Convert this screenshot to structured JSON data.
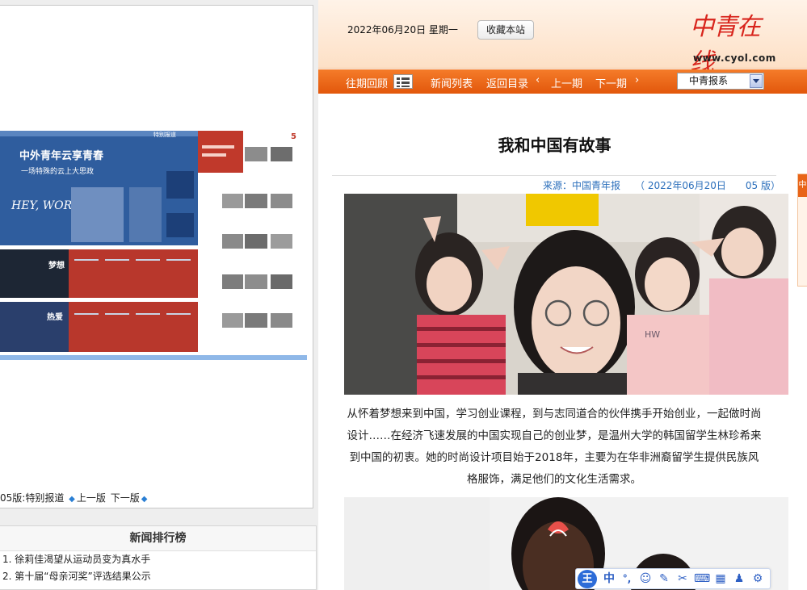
{
  "left": {
    "page_nav": {
      "current": "05版:特别报道",
      "prev": "上一版",
      "next": "下一版"
    },
    "paper_page": {
      "headline": "中外青年云享青春",
      "subhead": "一场特殊的云上大思政",
      "section": "特别报道",
      "page_number": "5",
      "dream": "梦想",
      "passion": "热爱",
      "hey_world": "HEY, WORLD"
    },
    "ranking": {
      "title": "新闻排行榜",
      "items": [
        "1. 徐莉佳渴望从运动员变为真水手",
        "2. 第十届“母亲河奖”评选结果公示"
      ]
    }
  },
  "header": {
    "date": "2022年06月20日  星期一",
    "bookmark": "收藏本站",
    "logo_text": "中青在线",
    "logo_url": "www.cyol.com"
  },
  "nav": {
    "back_issues": "往期回顾",
    "news_list": "新闻列表",
    "back_to_toc": "返回目录",
    "prev_issue": "上一期",
    "next_issue": "下一期",
    "paper_select": "中青报系"
  },
  "article": {
    "title": "我和中国有故事",
    "source": "来源：中国青年报　　（ 2022年06月20日　　05 版）",
    "body": "从怀着梦想来到中国，学习创业课程，到与志同道合的伙伴携手开始创业，一起做时尚设计……在经济飞速发展的中国实现自己的创业梦，是温州大学的韩国留学生林珍希来到中国的初衷。她的时尚设计项目始于2018年，主要为在华非洲裔留学生提供民族风格服饰，满足他们的文化生活需求。"
  },
  "side_tab": {
    "label": "中"
  },
  "ime": {
    "logo": "王",
    "mode": "中"
  },
  "colors": {
    "nav_orange": "#e8641a",
    "link_blue": "#2a6ebb",
    "logo_red": "#d8241c"
  }
}
